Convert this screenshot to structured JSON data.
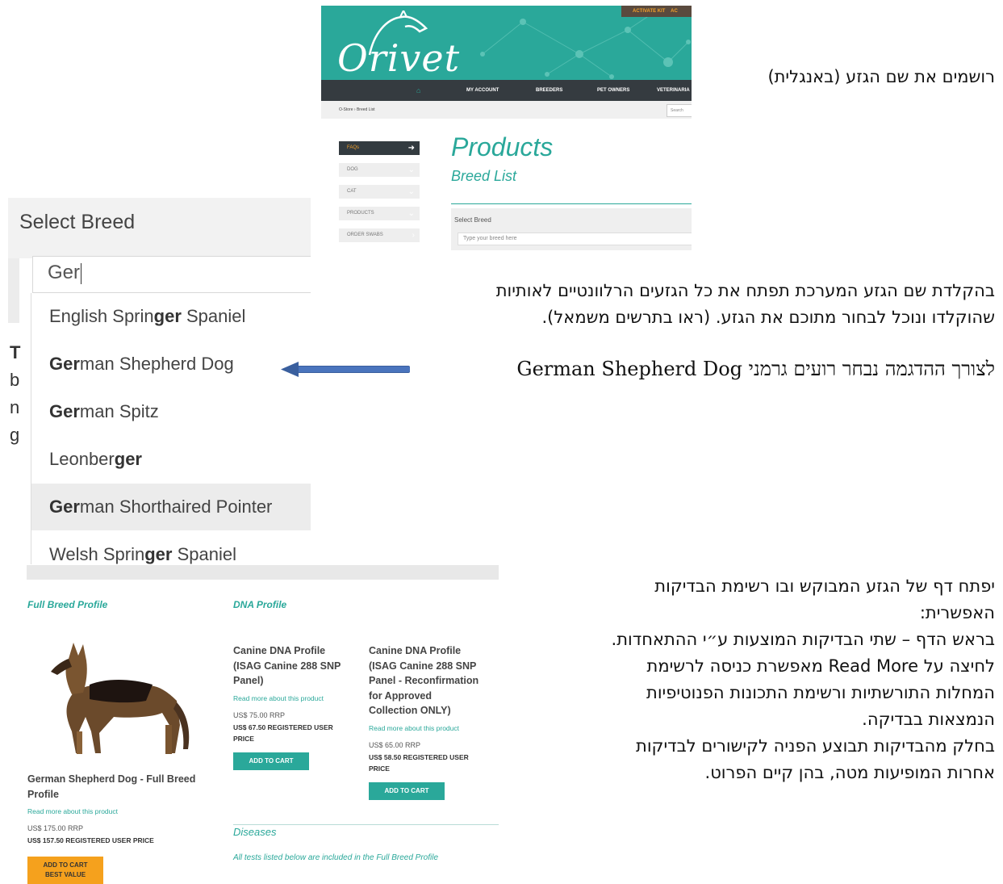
{
  "orivet": {
    "activate": "ACTIVATE KIT",
    "activate_cut": "AC",
    "logo": "Orivet",
    "nav": [
      "MY ACCOUNT",
      "BREEDERS",
      "PET OWNERS",
      "VETERINARIA"
    ],
    "breadcrumb": "O-Store › Breed List",
    "search": "Search"
  },
  "products": {
    "title": "Products",
    "subtitle": "Breed List",
    "sidebar": [
      "FAQs",
      "DOG",
      "CAT",
      "PRODUCTS",
      "ORDER SWABS"
    ],
    "select_label": "Select Breed",
    "input_placeholder": "Type your breed here"
  },
  "breed_select": {
    "label": "Select Breed",
    "input_value": "Ger",
    "options": [
      {
        "pre": "English Sprin",
        "bold": "ger",
        "post": " Spaniel"
      },
      {
        "pre": "",
        "bold": "Ger",
        "post": "man Shepherd Dog"
      },
      {
        "pre": "",
        "bold": "Ger",
        "post": "man Spitz"
      },
      {
        "pre": "Leonber",
        "bold": "ger",
        "post": ""
      },
      {
        "pre": "",
        "bold": "Ger",
        "post": "man Shorthaired Pointer"
      },
      {
        "pre": "Welsh Sprin",
        "bold": "ger",
        "post": " Spaniel"
      }
    ],
    "side_fragment": [
      "T",
      "b",
      "n",
      "g"
    ]
  },
  "annotations": {
    "t1": "רושמים את שם הגזע (באנגלית)",
    "t2a": "בהקלדת שם הגזע המערכת תפתח את כל  הגזעים הרלוונטיים לאותיות",
    "t2b": "שהוקלדו ונוכל לבחור מתוכם את הגזע. (ראו בתרשים משמאל).",
    "t3": "לצורך ההדגמה נבחר רועים גרמני German Shepherd Dog",
    "t4": [
      "יפתח דף של הגזע המבוקש ובו רשימת הבדיקות",
      "האפשרית:",
      "בראש הדף – שתי הבדיקות המוצעות ע״י ההתאחדות.",
      "לחיצה על Read More מאפשרת כניסה לרשימת",
      "המחלות התורשתיות  ורשימת התכונות הפנוטיפיות",
      "הנמצאות בבדיקה.",
      "בחלק מהבדיקות תבוצע הפניה לקישורים לבדיקות",
      "אחרות המופיעות מטה, בהן קיים הפרוט."
    ]
  },
  "profile": {
    "full_breed_heading": "Full Breed Profile",
    "dna_heading": "DNA Profile",
    "full_name": [
      "German Shepherd Dog - Full Breed",
      "Profile"
    ],
    "full_readmore": "Read more about this product",
    "full_rrp": "US$ 175.00 RRP",
    "full_reg": "US$ 157.50 REGISTERED USER PRICE",
    "full_button": [
      "ADD TO CART",
      "BEST VALUE"
    ],
    "p1_name": [
      "Canine DNA Profile",
      "(ISAG Canine 288 SNP",
      "Panel)"
    ],
    "p1_readmore": "Read more about this product",
    "p1_rrp": "US$ 75.00 RRP",
    "p1_reg": [
      "US$ 67.50 REGISTERED USER",
      "PRICE"
    ],
    "p1_button": "ADD TO CART",
    "p2_name": [
      "Canine DNA Profile",
      "(ISAG Canine 288 SNP",
      "Panel - Reconfirmation",
      "for Approved",
      "Collection ONLY)"
    ],
    "p2_readmore": "Read more about this product",
    "p2_rrp": "US$ 65.00 RRP",
    "p2_reg": [
      "US$ 58.50 REGISTERED USER",
      "PRICE"
    ],
    "p2_button": "ADD TO CART",
    "diseases_heading": "Diseases",
    "diseases_note": "All tests listed below are included in the Full Breed Profile"
  },
  "colors": {
    "teal": "#2aa89a",
    "nav": "#353b40",
    "orange": "#f5a11d",
    "arrow": "#3a5f9e"
  }
}
